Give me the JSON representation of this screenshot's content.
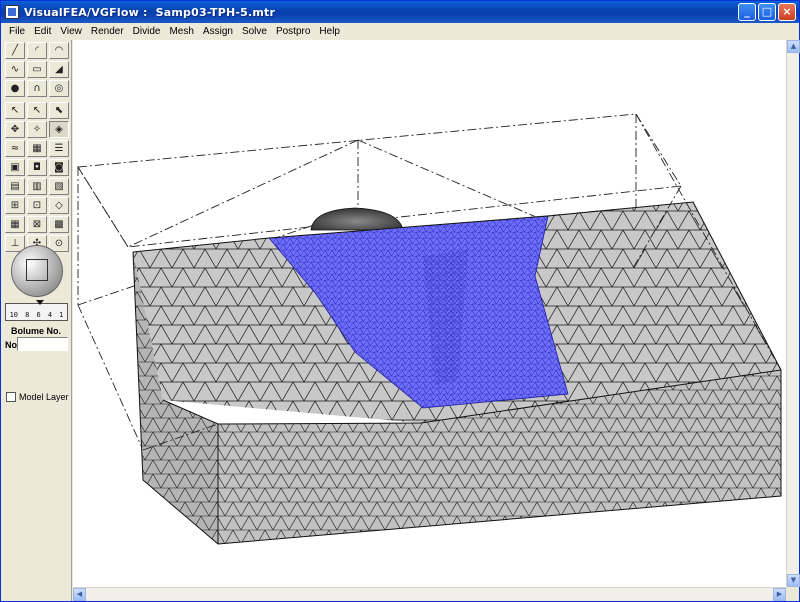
{
  "window": {
    "title": "VisualFEA/VGFlow :  Samp03-TPH-5.mtr"
  },
  "menu": [
    "File",
    "Edit",
    "View",
    "Render",
    "Divide",
    "Mesh",
    "Assign",
    "Solve",
    "Postpro",
    "Help"
  ],
  "toolbox": {
    "ruler_ticks": [
      "10",
      "8",
      "6",
      "4",
      "1"
    ],
    "volume_label": "Bolume No.",
    "no_label": "No",
    "volume_value": "",
    "model_layer_label": "Model Layer"
  },
  "colors": {
    "mesh_body": "#c4c4c4",
    "mesh_blue": "#6b6bf0",
    "titlebar": "#0842b0"
  }
}
